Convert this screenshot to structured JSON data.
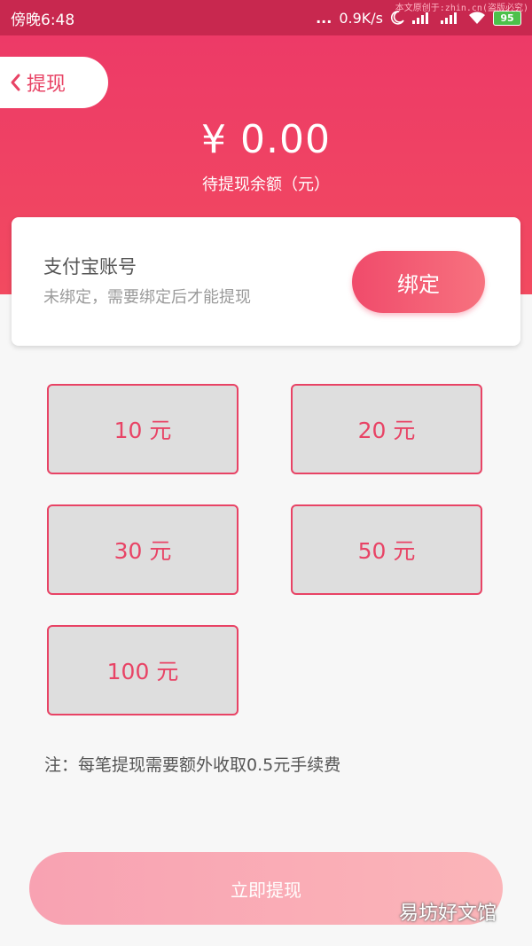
{
  "status_bar": {
    "time": "傍晚6:48",
    "dots": "...",
    "network_speed": "0.9K/s",
    "battery": "95",
    "watermark": "本文原创于:zhin.cn(盗版必究)"
  },
  "nav": {
    "back_label": "提现"
  },
  "balance": {
    "amount": "¥ 0.00",
    "label": "待提现余额（元）"
  },
  "account": {
    "title": "支付宝账号",
    "subtitle": "未绑定，需要绑定后才能提现",
    "bind_label": "绑定"
  },
  "amount_options": [
    {
      "label": "10 元"
    },
    {
      "label": "20 元"
    },
    {
      "label": "30 元"
    },
    {
      "label": "50 元"
    },
    {
      "label": "100 元"
    }
  ],
  "note": "注：每笔提现需要额外收取0.5元手续费",
  "withdraw_button": "立即提现",
  "watermark_bottom": "易坊好文馆",
  "colors": {
    "primary": "#e84365",
    "status_bar": "#c8284f",
    "option_bg": "#dedede",
    "button_light": "#f8a2b2"
  }
}
